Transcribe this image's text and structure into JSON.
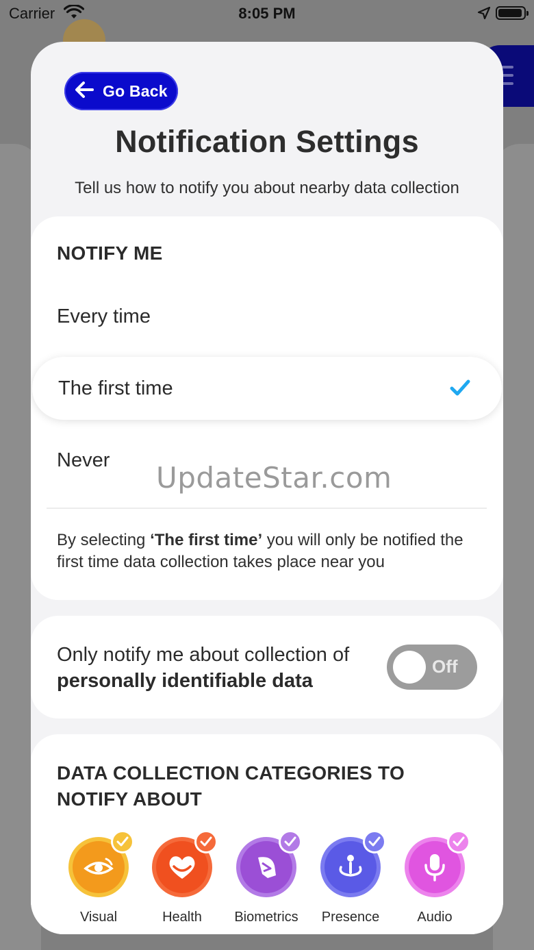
{
  "status_bar": {
    "carrier": "Carrier",
    "time": "8:05 PM"
  },
  "header": {
    "back_label": "Go Back",
    "title": "Notification Settings",
    "subtitle": "Tell us how to notify you about nearby data collection"
  },
  "notify": {
    "heading": "NOTIFY ME",
    "options": [
      {
        "label": "Every time",
        "selected": false
      },
      {
        "label": "The first time",
        "selected": true
      },
      {
        "label": "Never",
        "selected": false
      }
    ],
    "explanation_pre": "By selecting ",
    "explanation_bold": "‘The first time’",
    "explanation_post": " you will only be notified the first time data collection takes place near you"
  },
  "pii": {
    "text_line1": "Only notify me about collection of",
    "text_line2": "personally identifiable data",
    "toggle_state": "Off",
    "toggle_on": false
  },
  "categories": {
    "heading": "DATA COLLECTION CATEGORIES TO NOTIFY ABOUT",
    "items": [
      {
        "label": "Visual",
        "icon": "eye-icon",
        "color": "#f39a1c",
        "badge": "#f6c23a",
        "checked": true
      },
      {
        "label": "Health",
        "icon": "heart-icon",
        "color": "#f0501f",
        "badge": "#f56a3a",
        "checked": true
      },
      {
        "label": "Biometrics",
        "icon": "biometrics-icon",
        "color": "#9b4fd6",
        "badge": "#b27ae6",
        "checked": true
      },
      {
        "label": "Presence",
        "icon": "presence-icon",
        "color": "#5a5ae6",
        "badge": "#7b7bf0",
        "checked": true
      },
      {
        "label": "Audio",
        "icon": "microphone-icon",
        "color": "#e055e0",
        "badge": "#ec83ec",
        "checked": true
      }
    ]
  },
  "watermark": "UpdateStar.com",
  "colors": {
    "accent": "#0b0bcc",
    "check": "#1fa8f0",
    "toggle_off": "#9c9c9c"
  }
}
